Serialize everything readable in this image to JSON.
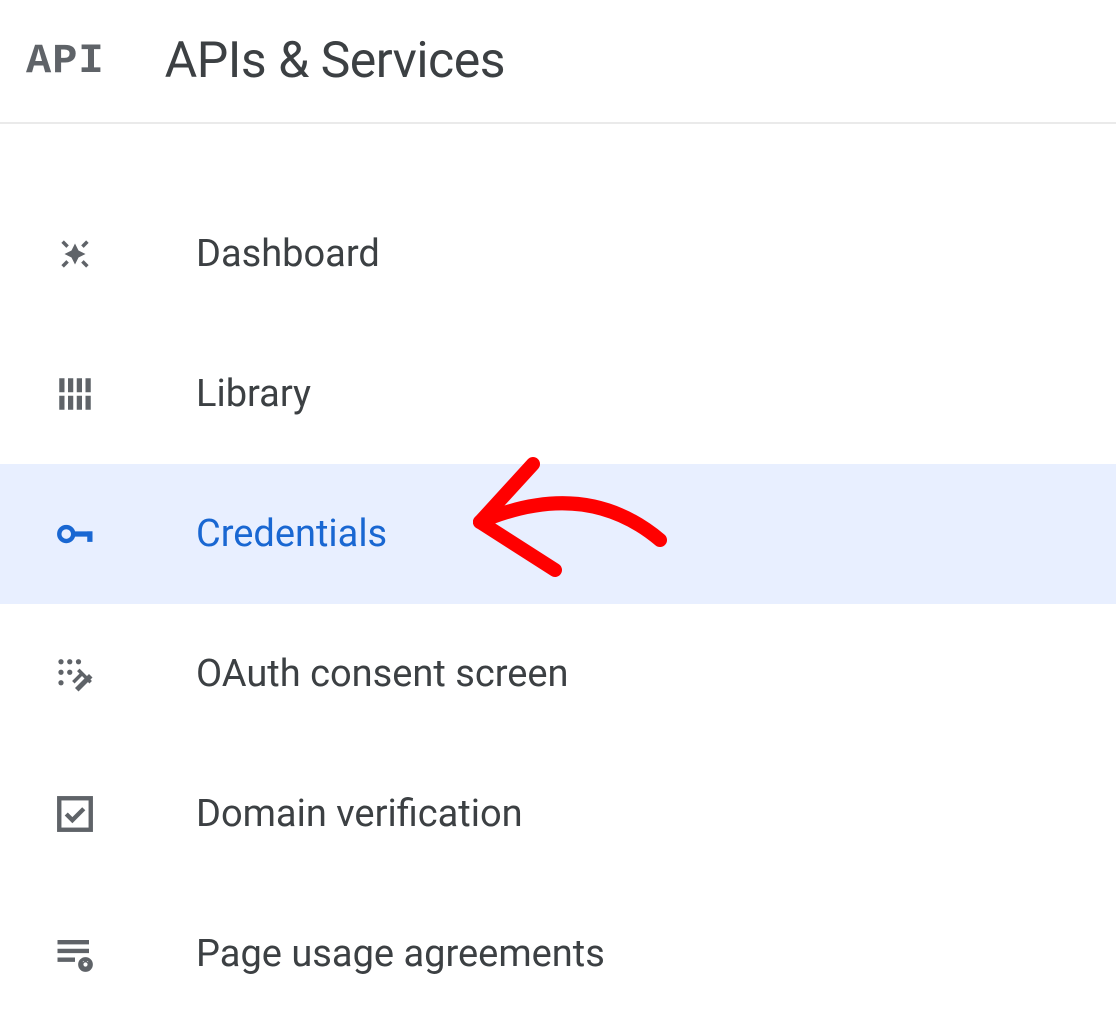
{
  "header": {
    "logo": "API",
    "title": "APIs & Services"
  },
  "nav": {
    "items": [
      {
        "label": "Dashboard",
        "icon": "dashboard",
        "selected": false
      },
      {
        "label": "Library",
        "icon": "library",
        "selected": false
      },
      {
        "label": "Credentials",
        "icon": "key",
        "selected": true
      },
      {
        "label": "OAuth consent screen",
        "icon": "consent",
        "selected": false
      },
      {
        "label": "Domain verification",
        "icon": "check-box",
        "selected": false
      },
      {
        "label": "Page usage agreements",
        "icon": "agreements",
        "selected": false
      }
    ]
  },
  "colors": {
    "selected_bg": "#e8efff",
    "selected_text": "#1967d2",
    "icon_gray": "#5f6368",
    "text": "#3c4043",
    "annotation": "#ff0000"
  }
}
